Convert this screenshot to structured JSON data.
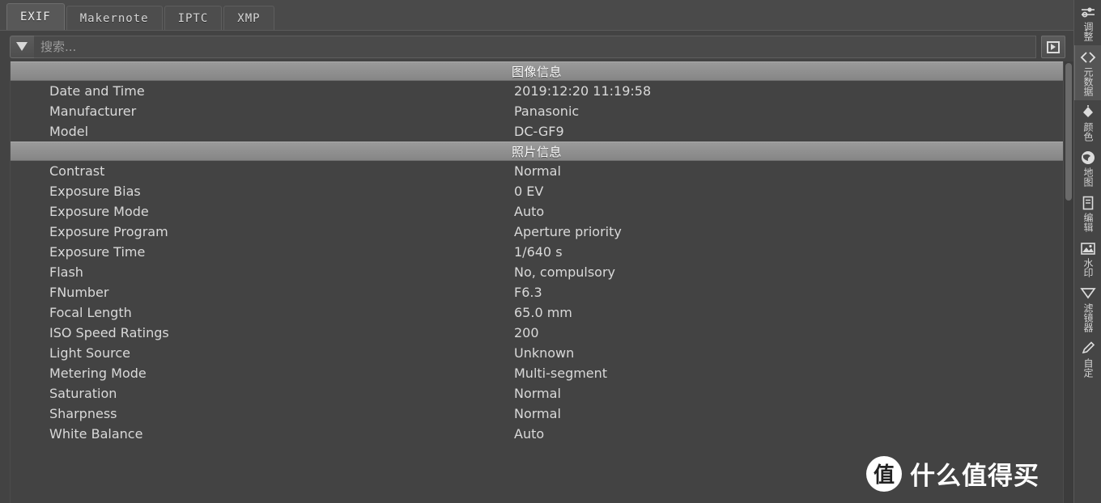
{
  "tabs": [
    {
      "label": "EXIF",
      "active": true
    },
    {
      "label": "Makernote",
      "active": false
    },
    {
      "label": "IPTC",
      "active": false
    },
    {
      "label": "XMP",
      "active": false
    }
  ],
  "search": {
    "placeholder": "搜索...",
    "value": "",
    "filter_icon": "funnel-icon",
    "action_icon": "panel-toggle-icon"
  },
  "groups": [
    {
      "title": "图像信息",
      "rows": [
        {
          "key": "Date and Time",
          "value": "2019:12:20 11:19:58"
        },
        {
          "key": "Manufacturer",
          "value": "Panasonic"
        },
        {
          "key": "Model",
          "value": "DC-GF9"
        }
      ]
    },
    {
      "title": "照片信息",
      "rows": [
        {
          "key": "Contrast",
          "value": "Normal"
        },
        {
          "key": "Exposure Bias",
          "value": "0 EV"
        },
        {
          "key": "Exposure Mode",
          "value": "Auto"
        },
        {
          "key": "Exposure Program",
          "value": "Aperture priority"
        },
        {
          "key": "Exposure Time",
          "value": "1/640 s"
        },
        {
          "key": "Flash",
          "value": "No, compulsory"
        },
        {
          "key": "FNumber",
          "value": "F6.3"
        },
        {
          "key": "Focal Length",
          "value": "65.0 mm"
        },
        {
          "key": "ISO Speed Ratings",
          "value": "200"
        },
        {
          "key": "Light Source",
          "value": "Unknown"
        },
        {
          "key": "Metering Mode",
          "value": "Multi-segment"
        },
        {
          "key": "Saturation",
          "value": "Normal"
        },
        {
          "key": "Sharpness",
          "value": "Normal"
        },
        {
          "key": "White Balance",
          "value": "Auto"
        }
      ]
    }
  ],
  "rail": [
    {
      "label": "调整",
      "icon": "sliders-icon",
      "selected": false
    },
    {
      "label": "元数据",
      "icon": "code-brackets-icon",
      "selected": true
    },
    {
      "label": "颜色",
      "icon": "paint-bucket-icon",
      "selected": false
    },
    {
      "label": "地图",
      "icon": "globe-icon",
      "selected": false
    },
    {
      "label": "编辑",
      "icon": "document-icon",
      "selected": false
    },
    {
      "label": "水印",
      "icon": "watermark-image-icon",
      "selected": false
    },
    {
      "label": "滤镜器",
      "icon": "funnel-icon",
      "selected": false
    },
    {
      "label": "自定",
      "icon": "pencil-icon",
      "selected": false
    }
  ],
  "watermark": {
    "badge": "值",
    "text": "什么值得买"
  }
}
